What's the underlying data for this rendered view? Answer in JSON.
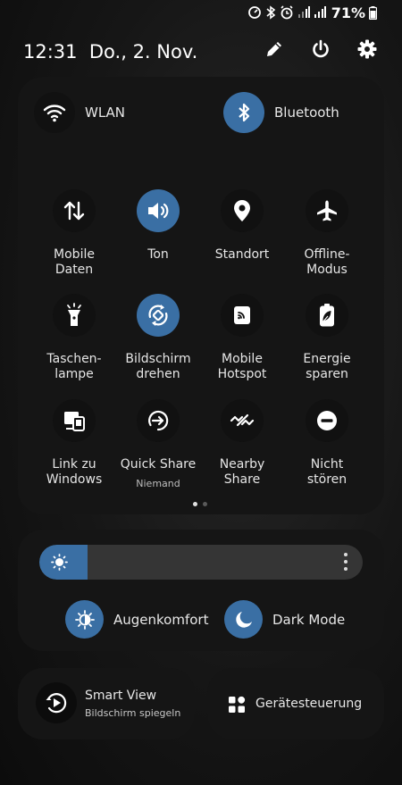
{
  "status_bar": {
    "battery": "71%",
    "icons": [
      "data-saver-icon",
      "bluetooth-icon",
      "alarm-icon",
      "signal-icon",
      "signal-icon",
      "battery-icon"
    ]
  },
  "header": {
    "time": "12:31",
    "date": "Do., 2. Nov.",
    "icons": [
      "edit-icon",
      "power-icon",
      "settings-icon"
    ]
  },
  "top_toggles": [
    {
      "label": "WLAN",
      "icon": "wifi-icon",
      "on": false
    },
    {
      "label": "Bluetooth",
      "icon": "bluetooth-icon",
      "on": true
    }
  ],
  "tiles": [
    {
      "label": "Mobile\nDaten",
      "icon": "mobile-data-icon",
      "on": false
    },
    {
      "label": "Ton",
      "icon": "sound-icon",
      "on": true
    },
    {
      "label": "Standort",
      "icon": "location-icon",
      "on": false
    },
    {
      "label": "Offline-\nModus",
      "icon": "airplane-icon",
      "on": false
    },
    {
      "label": "Taschen-\nlampe",
      "icon": "flashlight-icon",
      "on": false
    },
    {
      "label": "Bildschirm\ndrehen",
      "icon": "rotate-icon",
      "on": true
    },
    {
      "label": "Mobile\nHotspot",
      "icon": "hotspot-icon",
      "on": false
    },
    {
      "label": "Energie\nsparen",
      "icon": "battery-saver-icon",
      "on": false
    },
    {
      "label": "Link zu\nWindows",
      "icon": "link-windows-icon",
      "on": false
    },
    {
      "label": "Quick Share",
      "sub": "Niemand",
      "icon": "quick-share-icon",
      "on": false
    },
    {
      "label": "Nearby\nShare",
      "icon": "nearby-share-icon",
      "on": false
    },
    {
      "label": "Nicht\nstören",
      "icon": "dnd-icon",
      "on": false
    }
  ],
  "page_indicator": {
    "pages": 2,
    "current": 1
  },
  "brightness": {
    "level": 0.15,
    "accent": "#3a6fa4"
  },
  "mini_toggles": [
    {
      "label": "Augenkomfort",
      "icon": "eye-comfort-icon"
    },
    {
      "label": "Dark Mode",
      "icon": "moon-icon"
    }
  ],
  "cards": {
    "smart_view": {
      "title": "Smart View",
      "subtitle": "Bildschirm spiegeln"
    },
    "device_control": {
      "title": "Gerätesteuerung"
    }
  }
}
